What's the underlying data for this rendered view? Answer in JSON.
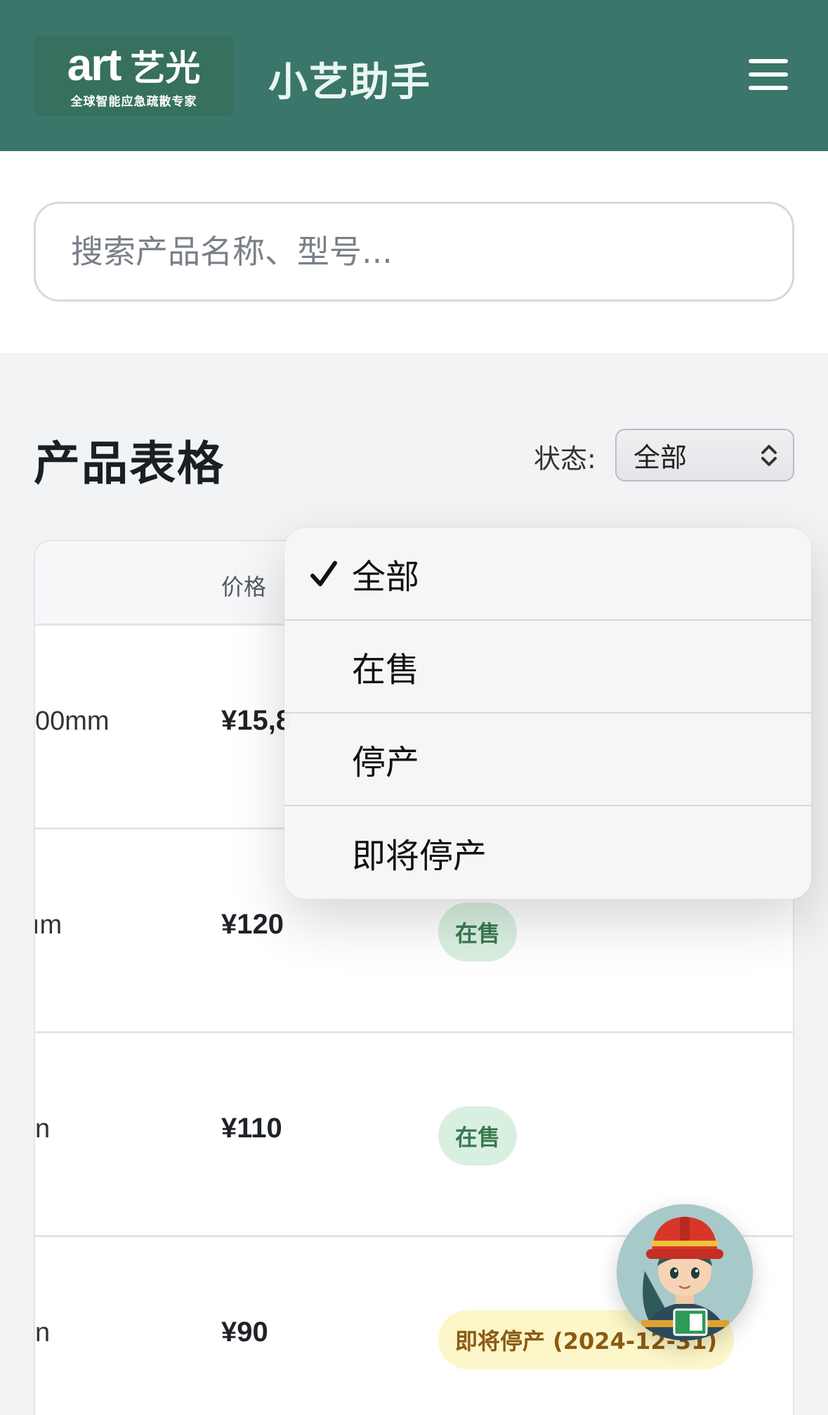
{
  "header": {
    "logo_art": "art",
    "logo_cn": "艺光",
    "logo_tagline": "全球智能应急疏散专家",
    "app_title": "小艺助手"
  },
  "search": {
    "placeholder": "搜索产品名称、型号..."
  },
  "section": {
    "title": "产品表格",
    "status_label": "状态:",
    "status_value": "全部"
  },
  "table": {
    "columns": [
      "价格"
    ],
    "rows": [
      {
        "spec": "00mm",
        "price": "¥15,8",
        "status": ""
      },
      {
        "spec": "ım",
        "price": "¥120",
        "status": "在售"
      },
      {
        "spec": "n",
        "price": "¥110",
        "status": "在售"
      },
      {
        "spec": "n",
        "price": "¥90",
        "status": "即将停产 (2024-12-31)"
      }
    ]
  },
  "dropdown": {
    "options": [
      "全部",
      "在售",
      "停产",
      "即将停产"
    ],
    "selected": "全部"
  },
  "colors": {
    "brand_green": "#3a7669",
    "badge_on_bg": "#d9f0e1",
    "badge_soon_bg": "#fdf6c8"
  },
  "icons": {
    "menu": "hamburger-icon",
    "select": "chevron-updown-icon",
    "check": "checkmark-icon",
    "assistant": "firefighter-avatar-icon"
  }
}
